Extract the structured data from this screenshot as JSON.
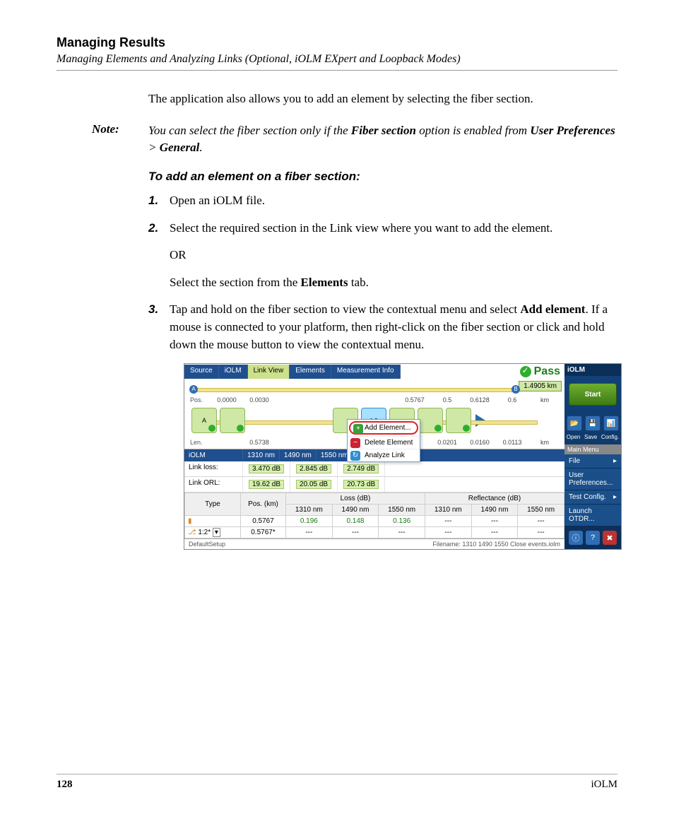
{
  "header": {
    "section_title": "Managing Results",
    "subtitle": "Managing Elements and Analyzing Links (Optional, iOLM EXpert and Loopback Modes)"
  },
  "intro": "The application also allows you to add an element by selecting the fiber section.",
  "note": {
    "label": "Note:",
    "pre": "You can select the fiber section only if the ",
    "b1": "Fiber section",
    "mid": " option is enabled from ",
    "b2": "User Preferences",
    "gt": " > ",
    "b3": "General",
    "post": "."
  },
  "procedure_title": "To add an element on a fiber section:",
  "steps": {
    "s1n": "1.",
    "s1": "Open an iOLM file.",
    "s2n": "2.",
    "s2": "Select the required section in the Link view where you want to add the element.",
    "s2or": "OR",
    "s2b_pre": "Select the section from the ",
    "s2b_b": "Elements",
    "s2b_post": " tab.",
    "s3n": "3.",
    "s3_pre": "Tap and hold on the fiber section to view the contextual menu and select ",
    "s3_b": "Add element",
    "s3_post": ". If a mouse is connected to your platform, then right-click on the fiber section or click and hold down the mouse button to view the contextual menu."
  },
  "app": {
    "tabs": [
      "Source",
      "iOLM",
      "Link View",
      "Elements",
      "Measurement Info"
    ],
    "active_tab": 2,
    "pass": "Pass",
    "distance_badge": "1.4905 km",
    "marker_a": "A",
    "marker_b": "B",
    "pos_lbl": "Pos.",
    "len_lbl": "Len.",
    "km": "km",
    "pos_values": [
      "0.0000",
      "0.0030",
      "0.5767",
      "0.5",
      "",
      "0.6128",
      "0.6"
    ],
    "len_values": [
      "",
      "0.5738",
      "",
      "",
      "0.0201",
      "0.0160",
      "0.0113"
    ],
    "splitter_label": "1:2",
    "context_menu": {
      "add": "Add Element...",
      "del": "Delete Element",
      "analyze": "Analyze Link"
    },
    "grid_title": "iOLM",
    "wl": [
      "1310 nm",
      "1490 nm",
      "1550 nm"
    ],
    "link_loss_lbl": "Link loss:",
    "link_loss": [
      "3.470 dB",
      "2.845 dB",
      "2.749 dB"
    ],
    "link_orl_lbl": "Link ORL:",
    "link_orl": [
      "19.62 dB",
      "20.05 dB",
      "20.73 dB"
    ],
    "tbl_headers": {
      "type": "Type",
      "pos": "Pos. (km)",
      "loss": "Loss (dB)",
      "refl": "Reflectance (dB)"
    },
    "tbl_rows": [
      {
        "type": "",
        "pos": "0.5767",
        "l1": "0.196",
        "l2": "0.148",
        "l3": "0.136",
        "r1": "---",
        "r2": "---",
        "r3": "---"
      },
      {
        "type": "1:2*",
        "pos": "0.5767*",
        "l1": "---",
        "l2": "---",
        "l3": "---",
        "r1": "---",
        "r2": "---",
        "r3": "---"
      }
    ],
    "status_left": "DefaultSetup",
    "status_right": "Filename: 1310 1490 1550 Close events.iolm",
    "sidebar": {
      "title": "iOLM",
      "start": "Start",
      "open": "Open",
      "save": "Save",
      "config": "Config.",
      "menu_title": "Main Menu",
      "file": "File",
      "userpref": "User Preferences...",
      "testcfg": "Test Config.",
      "launch": "Launch OTDR..."
    }
  },
  "footer": {
    "page": "128",
    "product": "iOLM"
  }
}
